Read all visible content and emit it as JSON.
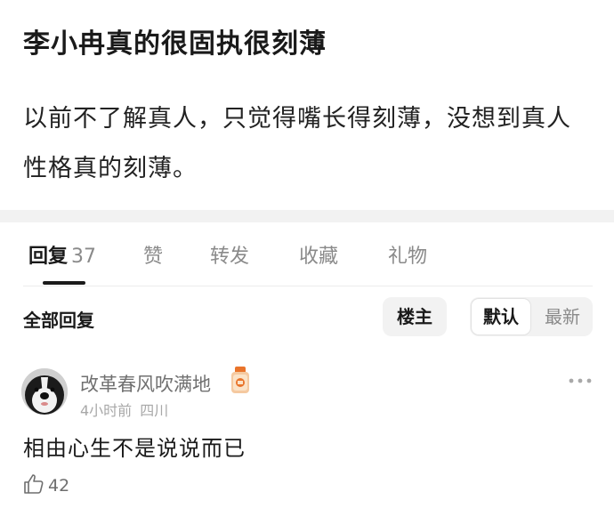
{
  "post": {
    "title": "李小冉真的很固执很刻薄",
    "body": "以前不了解真人，只觉得嘴长得刻薄，没想到真人性格真的刻薄。"
  },
  "tabs": [
    {
      "label": "回复",
      "count": "37",
      "active": true
    },
    {
      "label": "赞"
    },
    {
      "label": "转发"
    },
    {
      "label": "收藏"
    },
    {
      "label": "礼物"
    }
  ],
  "filters": {
    "all_replies_label": "全部回复",
    "owner_only_label": "楼主",
    "sort_default_label": "默认",
    "sort_latest_label": "最新"
  },
  "comments": [
    {
      "username": "改革春风吹满地",
      "time": "4小时前",
      "location": "四川",
      "text": "相由心生不是说说而已",
      "likes": "42",
      "avatar_icon": "dog-avatar-icon",
      "badge_icon": "gift-badge-icon"
    }
  ],
  "colors": {
    "text_primary": "#1a1a1a",
    "text_secondary": "#8a8a8a",
    "divider": "#f2f2f2",
    "badge_orange": "#e9742b"
  }
}
